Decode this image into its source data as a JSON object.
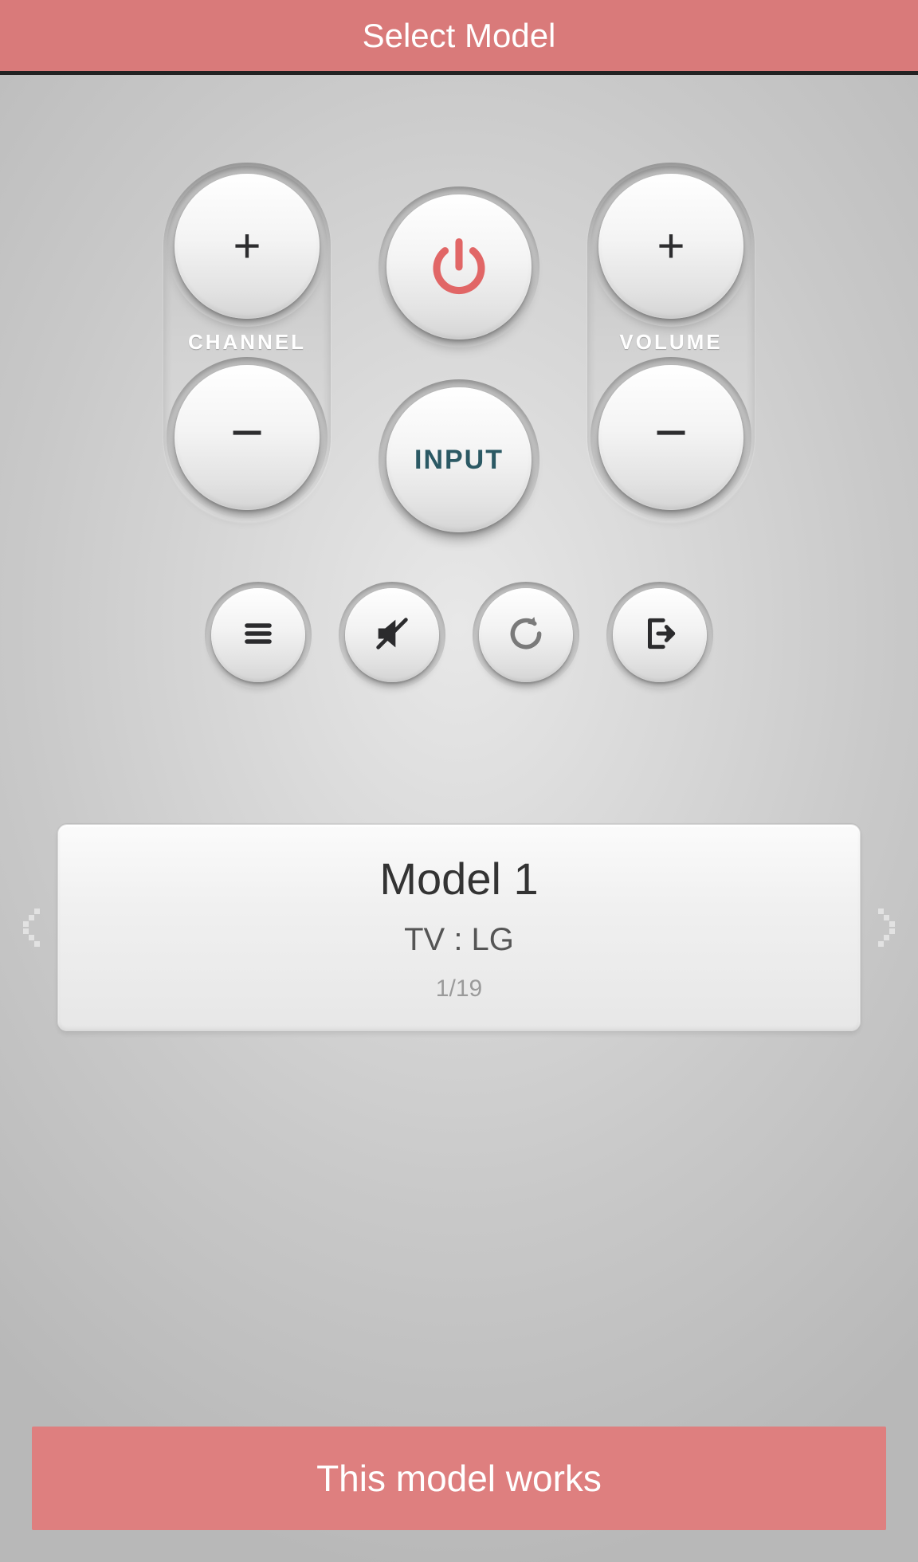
{
  "header": {
    "title": "Select Model"
  },
  "remote": {
    "channel_label": "CHANNEL",
    "volume_label": "VOLUME",
    "plus": "+",
    "minus": "−",
    "input_label": "INPUT",
    "icons": {
      "power": "power-icon",
      "menu": "menu-icon",
      "mute": "mute-icon",
      "refresh": "refresh-icon",
      "exit": "exit-icon"
    }
  },
  "model": {
    "name": "Model 1",
    "device": "TV : LG",
    "count": "1/19"
  },
  "confirm": {
    "label": "This model works"
  },
  "colors": {
    "accent": "#d97a7a",
    "power": "#e16666",
    "ink": "#2d2d2f",
    "teal": "#2b5964"
  }
}
